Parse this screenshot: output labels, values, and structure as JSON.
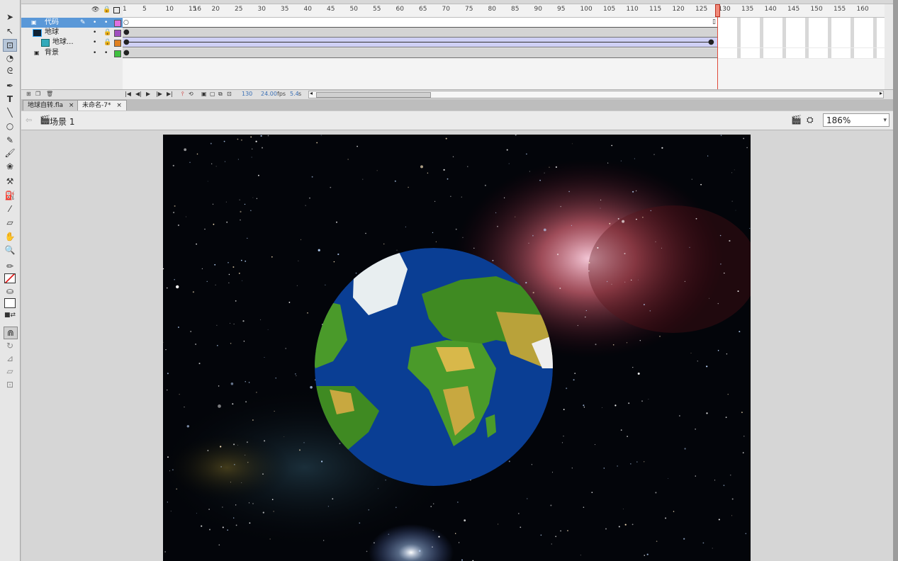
{
  "timeline": {
    "ruler_ticks": [
      "1",
      "5",
      "10",
      "15",
      "20",
      "25",
      "30",
      "35",
      "40",
      "45",
      "50",
      "55",
      "60",
      "65",
      "70",
      "75",
      "80",
      "85",
      "90",
      "95",
      "100",
      "105",
      "110",
      "115",
      "120",
      "125",
      "130",
      "135",
      "140",
      "145",
      "150",
      "155",
      "160",
      "16"
    ],
    "layers": [
      {
        "name": "代码",
        "color": "#e070e0"
      },
      {
        "name": "地球",
        "color": "#a050c0"
      },
      {
        "name": "地球...",
        "color": "#e08020"
      },
      {
        "name": "背景",
        "color": "#40c040"
      }
    ],
    "footer": {
      "current_frame": "130",
      "fps": "24.00",
      "fps_unit": "fps",
      "time": "5.4",
      "time_unit": "s"
    }
  },
  "tabs": [
    {
      "label": "地球自转.fla",
      "close": "×"
    },
    {
      "label": "未命名-7*",
      "close": "×"
    }
  ],
  "editbar": {
    "scene_label": "场景 1",
    "zoom": "186%"
  },
  "colors": {
    "accent": "#5a98d8",
    "playhead": "#e04a3a",
    "ocean": "#0a3e94"
  }
}
